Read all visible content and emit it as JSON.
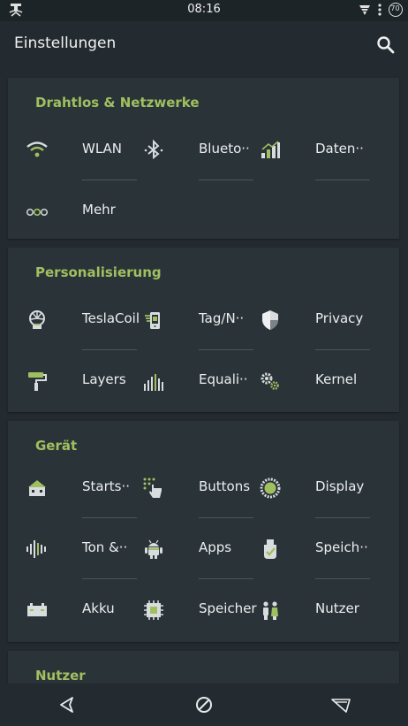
{
  "status_bar": {
    "time": "08:16",
    "battery_level": "70"
  },
  "app_bar": {
    "title": "Einstellungen"
  },
  "sections": [
    {
      "title": "Drahtlos & Netzwerke",
      "items": [
        {
          "label": "WLAN",
          "icon": "wifi-icon"
        },
        {
          "label": "Blueto··",
          "icon": "bluetooth-icon"
        },
        {
          "label": "Daten··",
          "icon": "data-usage-icon"
        },
        {
          "label": "Mehr",
          "icon": "more-icon"
        }
      ]
    },
    {
      "title": "Personalisierung",
      "items": [
        {
          "label": "TeslaCoil",
          "icon": "tesla-coil-icon"
        },
        {
          "label": "Tag/N··",
          "icon": "day-night-icon"
        },
        {
          "label": "Privacy",
          "icon": "shield-icon"
        },
        {
          "label": "Layers",
          "icon": "paint-roller-icon"
        },
        {
          "label": "Equali··",
          "icon": "equalizer-icon"
        },
        {
          "label": "Kernel",
          "icon": "gears-icon"
        }
      ]
    },
    {
      "title": "Gerät",
      "items": [
        {
          "label": "Starts··",
          "icon": "home-screen-icon"
        },
        {
          "label": "Buttons",
          "icon": "touch-icon"
        },
        {
          "label": "Display",
          "icon": "display-icon"
        },
        {
          "label": "Ton &··",
          "icon": "sound-icon"
        },
        {
          "label": "Apps",
          "icon": "android-icon"
        },
        {
          "label": "Speich··",
          "icon": "storage-icon"
        },
        {
          "label": "Akku",
          "icon": "battery-icon"
        },
        {
          "label": "Speicher",
          "icon": "memory-icon"
        },
        {
          "label": "Nutzer",
          "icon": "users-icon"
        }
      ]
    },
    {
      "title": "Nutzer",
      "items": []
    }
  ],
  "colors": {
    "accent": "#a0c060",
    "background": "#232b30",
    "card": "#2a3338",
    "text": "#eceeef",
    "icon": "#d8dcde"
  }
}
